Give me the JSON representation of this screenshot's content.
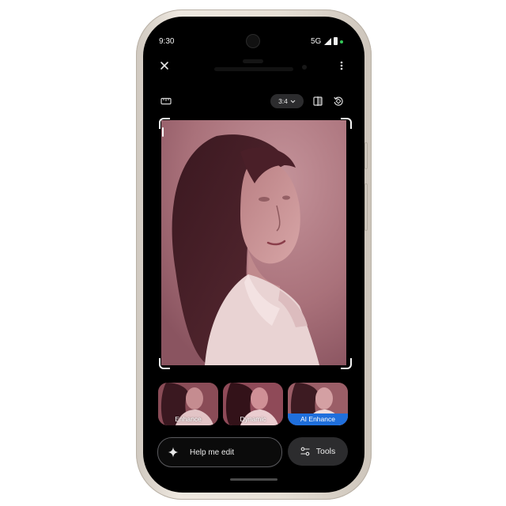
{
  "status_bar": {
    "time": "9:30",
    "network": "5G"
  },
  "toolbar": {
    "aspect_ratio": "3:4"
  },
  "suggestions": [
    {
      "label": "Enhance"
    },
    {
      "label": "Dynamic"
    },
    {
      "label": "AI Enhance",
      "selected": true
    }
  ],
  "actions": {
    "help_label": "Help me edit",
    "tools_label": "Tools"
  },
  "colors": {
    "accent": "#1f6fdc",
    "status_dot": "#34c759",
    "photo_tint": "#a56d76",
    "frame": "#e7e0d6"
  },
  "icons": [
    "close-icon",
    "more-vert-icon",
    "straighten-icon",
    "chevron-down-icon",
    "flip-icon",
    "rotate-icon",
    "sparkle-icon",
    "tune-icon"
  ]
}
